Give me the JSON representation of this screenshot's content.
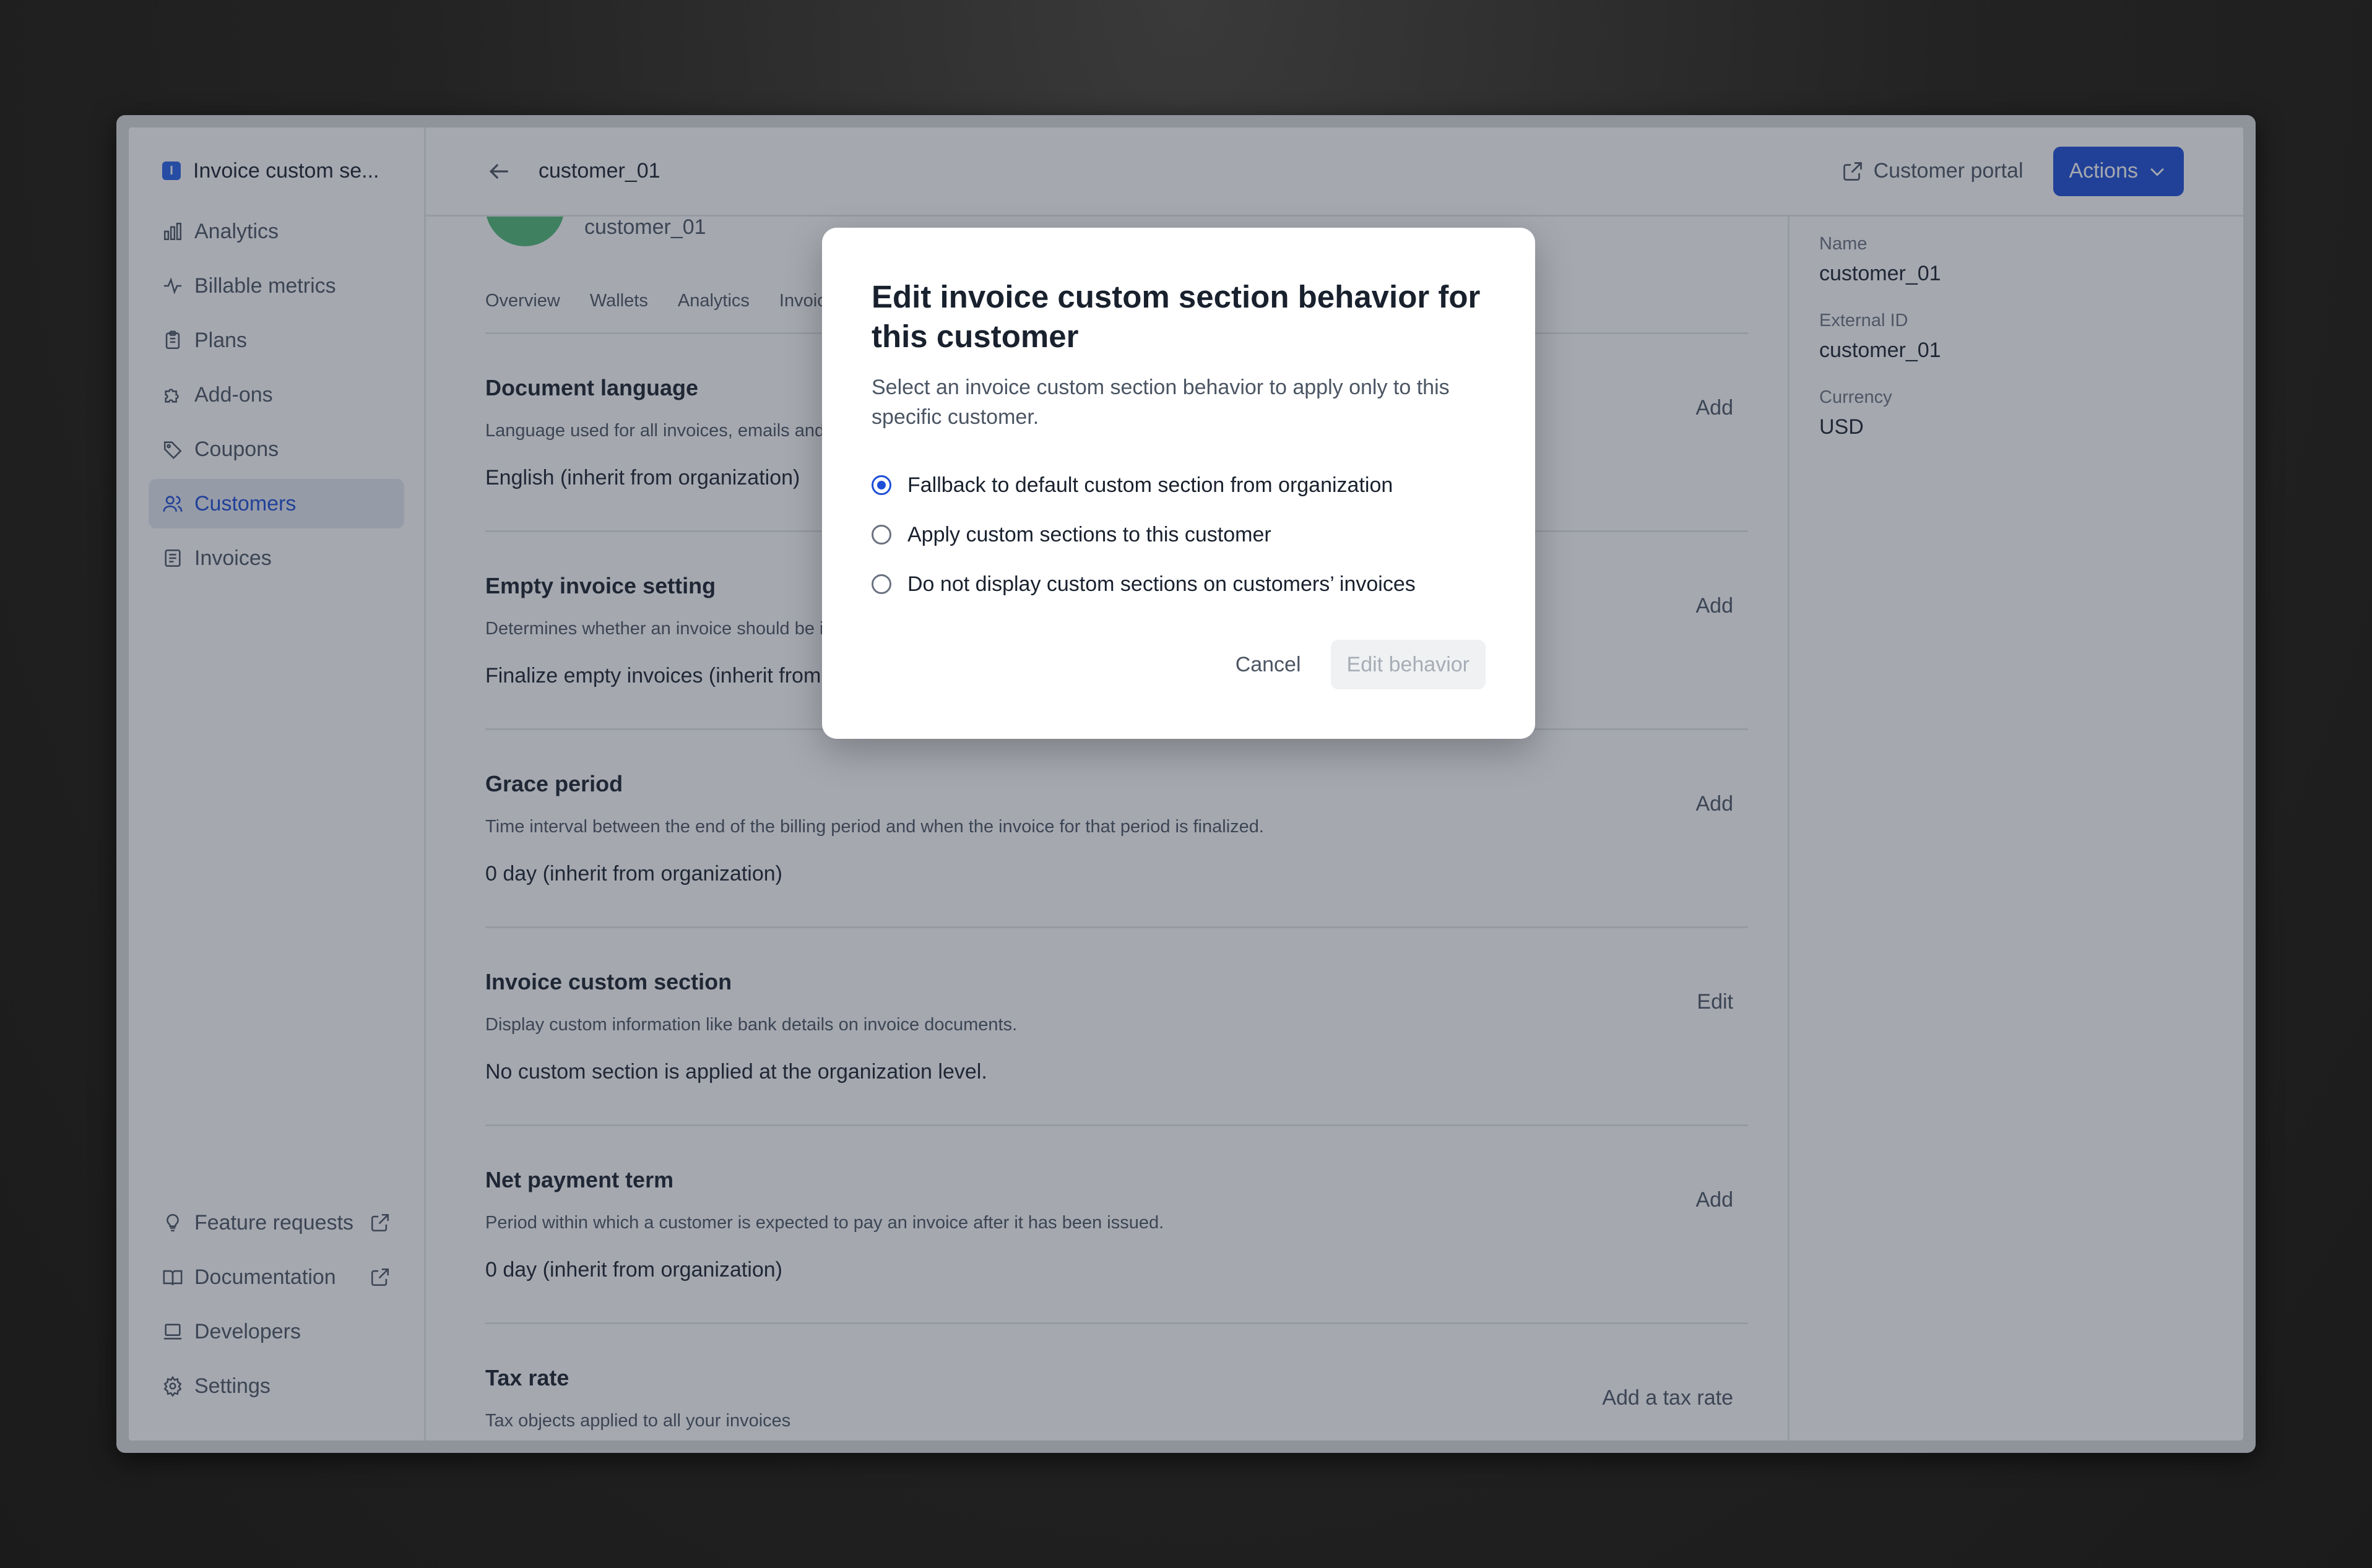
{
  "sidebar": {
    "org_badge": "I",
    "org_name": "Invoice custom se...",
    "items": [
      {
        "label": "Analytics",
        "icon": "bar-chart-icon"
      },
      {
        "label": "Billable metrics",
        "icon": "pulse-icon"
      },
      {
        "label": "Plans",
        "icon": "clipboard-icon"
      },
      {
        "label": "Add-ons",
        "icon": "puzzle-icon"
      },
      {
        "label": "Coupons",
        "icon": "tag-icon"
      },
      {
        "label": "Customers",
        "icon": "users-icon",
        "active": true
      },
      {
        "label": "Invoices",
        "icon": "document-icon"
      }
    ],
    "bottom_items": [
      {
        "label": "Feature requests",
        "icon": "lightbulb-icon",
        "external": true
      },
      {
        "label": "Documentation",
        "icon": "book-icon",
        "external": true
      },
      {
        "label": "Developers",
        "icon": "laptop-icon"
      },
      {
        "label": "Settings",
        "icon": "gear-icon"
      }
    ]
  },
  "header": {
    "title": "customer_01",
    "portal_label": "Customer portal",
    "actions_label": "Actions"
  },
  "customer": {
    "subtitle": "customer_01"
  },
  "tabs": [
    "Overview",
    "Wallets",
    "Analytics",
    "Invoic"
  ],
  "sections": [
    {
      "title": "Document language",
      "desc": "Language used for all invoices, emails and",
      "value": "English (inherit from organization)",
      "action": "Add"
    },
    {
      "title": "Empty invoice setting",
      "desc": "Determines whether an invoice should be is",
      "value": "Finalize empty invoices (inherit from o",
      "action": "Add"
    },
    {
      "title": "Grace period",
      "desc": "Time interval between the end of the billing period and when the invoice for that period is finalized.",
      "value": "0 day (inherit from organization)",
      "action": "Add"
    },
    {
      "title": "Invoice custom section",
      "desc": "Display custom information like bank details on invoice documents.",
      "value": "No custom section is applied at the organization level.",
      "action": "Edit"
    },
    {
      "title": "Net payment term",
      "desc": "Period within which a customer is expected to pay an invoice after it has been issued.",
      "value": "0 day (inherit from organization)",
      "action": "Add"
    },
    {
      "title": "Tax rate",
      "desc": "Tax objects applied to all your invoices",
      "value": "",
      "action": "Add a tax rate"
    }
  ],
  "info": {
    "name_label": "Name",
    "name_value": "customer_01",
    "external_id_label": "External ID",
    "external_id_value": "customer_01",
    "currency_label": "Currency",
    "currency_value": "USD"
  },
  "modal": {
    "title": "Edit invoice custom section behavior for this customer",
    "description": "Select an invoice custom section behavior to apply only to this specific customer.",
    "options": [
      {
        "label": "Fallback to default custom section from organization",
        "checked": true
      },
      {
        "label": "Apply custom sections to this customer",
        "checked": false
      },
      {
        "label": "Do not display custom sections on customers’ invoices",
        "checked": false
      }
    ],
    "cancel_label": "Cancel",
    "submit_label": "Edit behavior"
  },
  "colors": {
    "accent": "#1d4ed8",
    "avatar": "#16a34a"
  }
}
